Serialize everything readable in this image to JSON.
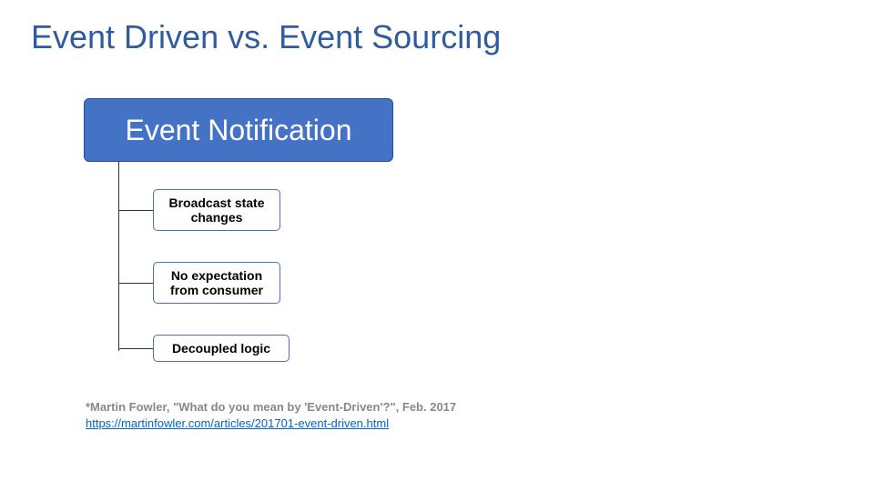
{
  "title": "Event Driven vs. Event Sourcing",
  "diagram": {
    "header": "Event Notification",
    "nodes": [
      "Broadcast state changes",
      "No expectation from consumer",
      "Decoupled logic"
    ]
  },
  "citation": "*Martin Fowler, \"What do you mean by 'Event-Driven'?\", Feb. 2017",
  "link": "https://martinfowler.com/articles/201701-event-driven.html",
  "colors": {
    "title": "#2f5b9f",
    "boxfill": "#4472c4",
    "link": "#0563c1"
  }
}
